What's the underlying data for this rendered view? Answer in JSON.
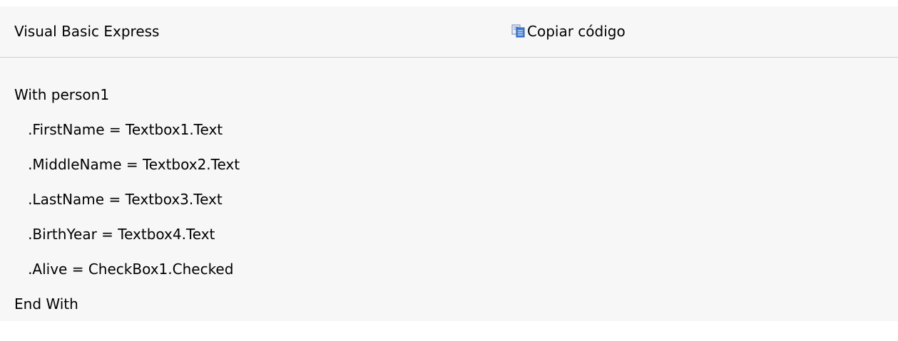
{
  "snippet": {
    "language_label": "Visual Basic Express",
    "copy_label": "Copiar código",
    "copy_icon": "copy-icon",
    "code_lines": [
      "With person1",
      "   .FirstName = Textbox1.Text",
      "   .MiddleName = Textbox2.Text",
      "   .LastName = Textbox3.Text",
      "   .BirthYear = Textbox4.Text",
      "   .Alive = CheckBox1.Checked",
      "End With"
    ]
  }
}
